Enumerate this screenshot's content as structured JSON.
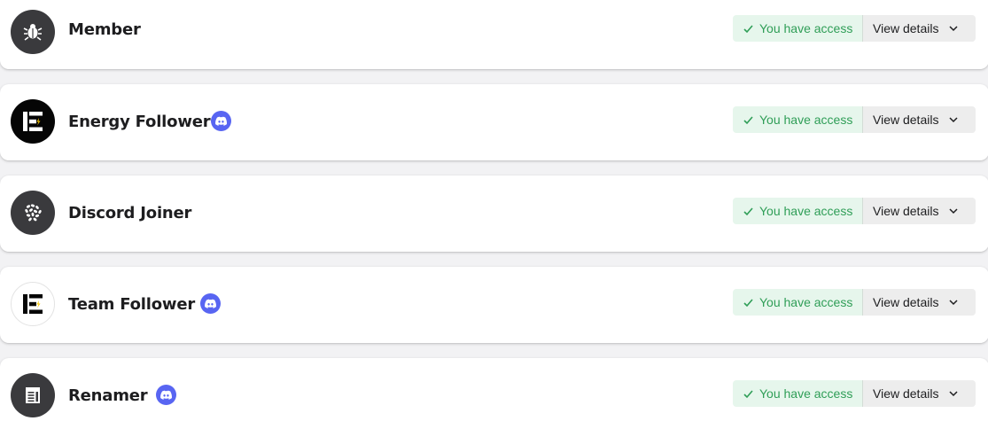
{
  "roles": [
    {
      "name": "Member",
      "has_discord": false,
      "access_label": "You have access",
      "details_label": "View details"
    },
    {
      "name": "Energy Follower",
      "has_discord": true,
      "access_label": "You have access",
      "details_label": "View details"
    },
    {
      "name": "Discord Joiner",
      "has_discord": false,
      "access_label": "You have access",
      "details_label": "View details"
    },
    {
      "name": "Team Follower",
      "has_discord": true,
      "access_label": "You have access",
      "details_label": "View details"
    },
    {
      "name": "Renamer",
      "has_discord": true,
      "access_label": "You have access",
      "details_label": "View details"
    }
  ],
  "icons": {
    "member": "bug-badge-icon",
    "energy": "energy-logo-icon",
    "joiner": "snowflake-cluster-icon",
    "team": "energy-logo-icon",
    "renamer": "document-list-icon",
    "discord": "discord-icon",
    "check": "check-icon",
    "chevron": "chevron-down-icon"
  },
  "colors": {
    "access_text": "#2f9e57",
    "access_bg": "#e6f6ec",
    "details_bg": "#ededed",
    "discord": "#5865f2",
    "page_bg": "#f2f2f4"
  }
}
